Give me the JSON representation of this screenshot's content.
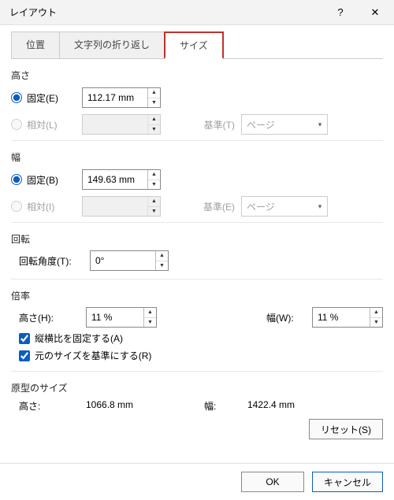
{
  "title": "レイアウト",
  "tabs": [
    "位置",
    "文字列の折り返し",
    "サイズ"
  ],
  "height": {
    "label": "高さ",
    "fixed_label": "固定(E)",
    "fixed_value": "112.17 mm",
    "relative_label": "相対(L)",
    "relative_value": "",
    "ref_label": "基準(T)",
    "ref_value": "ページ"
  },
  "width": {
    "label": "幅",
    "fixed_label": "固定(B)",
    "fixed_value": "149.63 mm",
    "relative_label": "相対(I)",
    "relative_value": "",
    "ref_label": "基準(E)",
    "ref_value": "ページ"
  },
  "rotation": {
    "label": "回転",
    "angle_label": "回転角度(T):",
    "angle_value": "0°"
  },
  "scale": {
    "label": "倍率",
    "h_label": "高さ(H):",
    "h_value": "11 %",
    "w_label": "幅(W):",
    "w_value": "11 %",
    "lock_label": "縦横比を固定する(A)",
    "orig_label": "元のサイズを基準にする(R)"
  },
  "original": {
    "label": "原型のサイズ",
    "h_label": "高さ:",
    "h_value": "1066.8 mm",
    "w_label": "幅:",
    "w_value": "1422.4 mm"
  },
  "reset_label": "リセット(S)",
  "ok_label": "OK",
  "cancel_label": "キャンセル"
}
